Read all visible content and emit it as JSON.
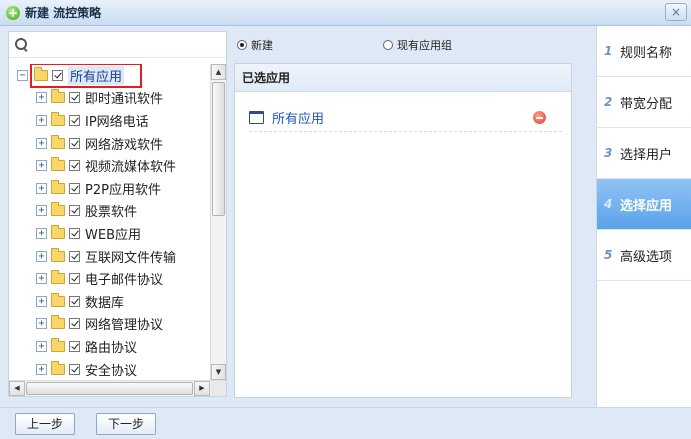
{
  "window": {
    "title": "新建 流控策略",
    "close_glyph": "×"
  },
  "search": {
    "placeholder": "",
    "value": ""
  },
  "tree": {
    "root": {
      "label": "所有应用",
      "expand": "−",
      "checked": true
    },
    "children": [
      {
        "label": "即时通讯软件",
        "expand": "+",
        "checked": true
      },
      {
        "label": "IP网络电话",
        "expand": "+",
        "checked": true
      },
      {
        "label": "网络游戏软件",
        "expand": "+",
        "checked": true
      },
      {
        "label": "视频流媒体软件",
        "expand": "+",
        "checked": true
      },
      {
        "label": "P2P应用软件",
        "expand": "+",
        "checked": true
      },
      {
        "label": "股票软件",
        "expand": "+",
        "checked": true
      },
      {
        "label": "WEB应用",
        "expand": "+",
        "checked": true
      },
      {
        "label": "互联网文件传输",
        "expand": "+",
        "checked": true
      },
      {
        "label": "电子邮件协议",
        "expand": "+",
        "checked": true
      },
      {
        "label": "数据库",
        "expand": "+",
        "checked": true
      },
      {
        "label": "网络管理协议",
        "expand": "+",
        "checked": true
      },
      {
        "label": "路由协议",
        "expand": "+",
        "checked": true
      },
      {
        "label": "安全协议",
        "expand": "+",
        "checked": true
      }
    ]
  },
  "mode": {
    "new_label": "新建",
    "existing_label": "现有应用组",
    "selected": "new"
  },
  "selected_apps": {
    "header": "已选应用",
    "items": [
      {
        "label": "所有应用"
      }
    ]
  },
  "steps": [
    {
      "num": "1",
      "label": "规则名称",
      "active": false
    },
    {
      "num": "2",
      "label": "带宽分配",
      "active": false
    },
    {
      "num": "3",
      "label": "选择用户",
      "active": false
    },
    {
      "num": "4",
      "label": "选择应用",
      "active": true
    },
    {
      "num": "5",
      "label": "高级选项",
      "active": false
    }
  ],
  "footer": {
    "prev_label": "上一步",
    "next_label": "下一步"
  },
  "colors": {
    "active_step": "#5aa2ea",
    "highlight_border": "#e02020",
    "link_blue": "#1e57b8"
  }
}
